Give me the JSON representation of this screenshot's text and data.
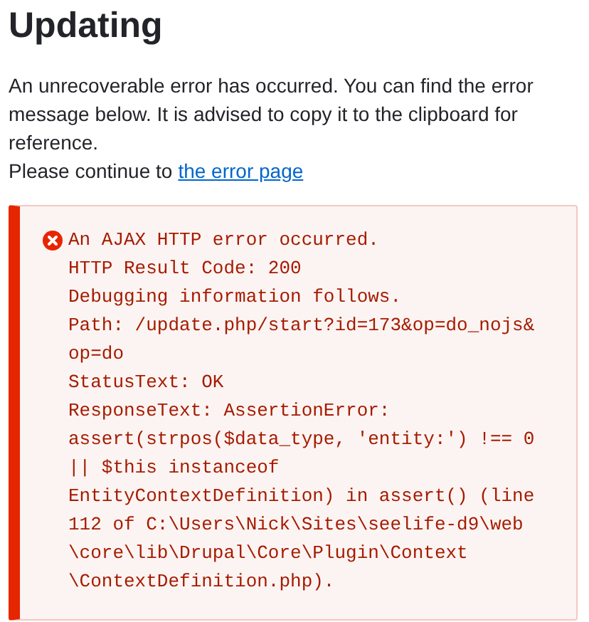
{
  "title": "Updating",
  "intro": "An unrecoverable error has occurred. You can find the error message below. It is advised to copy it to the clipboard for reference.",
  "continue": {
    "text": "Please continue to",
    "link": "the error page"
  },
  "error_message": {
    "lines": [
      "An AJAX HTTP error occurred.",
      "HTTP Result Code: 200",
      "Debugging information follows.",
      "Path: /update.php/start?id=173&op=do_nojs&",
      "op=do",
      "StatusText: OK",
      "ResponseText: AssertionError:",
      "assert(strpos($data_type, 'entity:') !== 0",
      "|| $this instanceof",
      "EntityContextDefinition) in assert() (line",
      "112 of C:\\Users\\Nick\\Sites\\seelife-d9\\web",
      "\\core\\lib\\Drupal\\Core\\Plugin\\Context",
      "\\ContextDefinition.php)."
    ]
  }
}
